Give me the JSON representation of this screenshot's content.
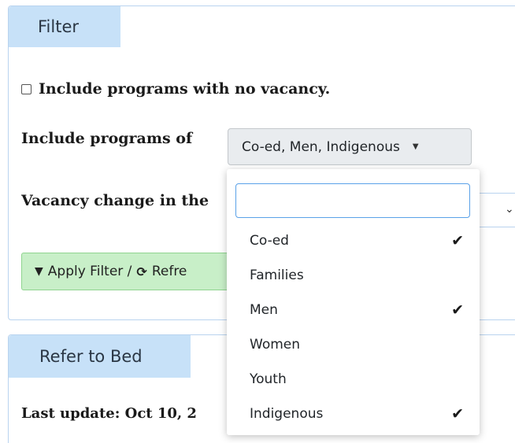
{
  "filter_panel": {
    "tab_label": "Filter",
    "no_vacancy_label": "Include programs with no vacancy.",
    "no_vacancy_checked": false,
    "include_programs_label": "Include programs of",
    "include_programs_value": "Co-ed, Men, Indigenous",
    "vacancy_change_label": "Vacancy change in the",
    "apply_button": {
      "filter_icon": "filter-icon",
      "refresh_icon": "refresh-icon",
      "apply_text": "Apply Filter /",
      "refresh_text": "Refre"
    }
  },
  "refer_panel": {
    "tab_label": "Refer to Bed",
    "last_update": "Last update: Oct 10, 2"
  },
  "dropdown": {
    "search_value": "",
    "options": [
      {
        "label": "Co-ed",
        "checked": true
      },
      {
        "label": "Families",
        "checked": false
      },
      {
        "label": "Men",
        "checked": true
      },
      {
        "label": "Women",
        "checked": false
      },
      {
        "label": "Youth",
        "checked": false
      },
      {
        "label": "Indigenous",
        "checked": true
      }
    ]
  },
  "colors": {
    "tab_bg": "#c7e1f8",
    "panel_border": "#b9d3ef",
    "apply_bg": "#c8efc8",
    "focus_border": "#5aa1e8"
  }
}
